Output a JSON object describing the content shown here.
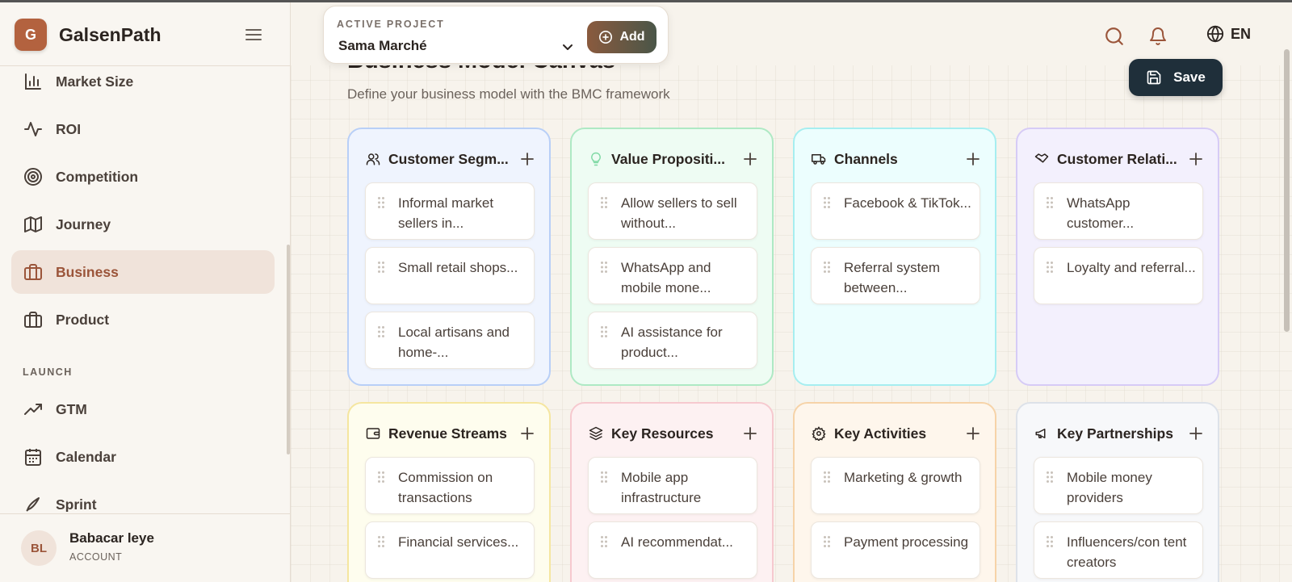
{
  "app": {
    "logo_letter": "G",
    "name": "GalsenPath",
    "accent": "#b3623f"
  },
  "sidebar": {
    "items": [
      {
        "label": "Market Size",
        "icon": "bar-chart-icon"
      },
      {
        "label": "ROI",
        "icon": "activity-icon"
      },
      {
        "label": "Competition",
        "icon": "target-icon"
      },
      {
        "label": "Journey",
        "icon": "map-icon"
      },
      {
        "label": "Business",
        "icon": "briefcase-icon",
        "active": true
      },
      {
        "label": "Product",
        "icon": "briefcase-icon"
      }
    ],
    "section_launch": "LAUNCH",
    "launch_items": [
      {
        "label": "GTM",
        "icon": "trending-up-icon"
      },
      {
        "label": "Calendar",
        "icon": "calendar-icon"
      },
      {
        "label": "Sprint",
        "icon": "rocket-icon"
      }
    ]
  },
  "account": {
    "initials": "BL",
    "name": "Babacar leye",
    "role": "ACCOUNT"
  },
  "header": {
    "project_label": "ACTIVE PROJECT",
    "project_value": "Sama Marché",
    "add_label": "Add",
    "language": "EN"
  },
  "page": {
    "title": "Business Model Canvas",
    "subtitle": "Define your business model with the BMC framework",
    "save_label": "Save"
  },
  "canvas": {
    "blocks": [
      {
        "title": "Customer Segm...",
        "icon": "users-icon",
        "items": [
          "Informal market sellers in...",
          "Small retail shops...",
          "Local artisans and home-..."
        ]
      },
      {
        "title": "Value Propositi...",
        "icon": "lightbulb-icon",
        "items": [
          "Allow sellers to sell without...",
          "WhatsApp and mobile mone...",
          "AI assistance for product..."
        ]
      },
      {
        "title": "Channels",
        "icon": "truck-icon",
        "items": [
          "Facebook & TikTok...",
          "Referral system between..."
        ]
      },
      {
        "title": "Customer Relati...",
        "icon": "handshake-icon",
        "items": [
          "WhatsApp customer...",
          "Loyalty and referral..."
        ]
      },
      {
        "title": "Revenue Streams",
        "icon": "wallet-icon",
        "items": [
          "Commission on transactions",
          "Financial services..."
        ]
      },
      {
        "title": "Key Resources",
        "icon": "layers-icon",
        "items": [
          "Mobile app infrastructure",
          "AI recommendat..."
        ]
      },
      {
        "title": "Key Activities",
        "icon": "gear-icon",
        "items": [
          "Marketing & growth",
          "Payment processing"
        ]
      },
      {
        "title": "Key Partnerships",
        "icon": "megaphone-icon",
        "items": [
          "Mobile money providers",
          "Influencers/con tent creators"
        ]
      }
    ]
  }
}
